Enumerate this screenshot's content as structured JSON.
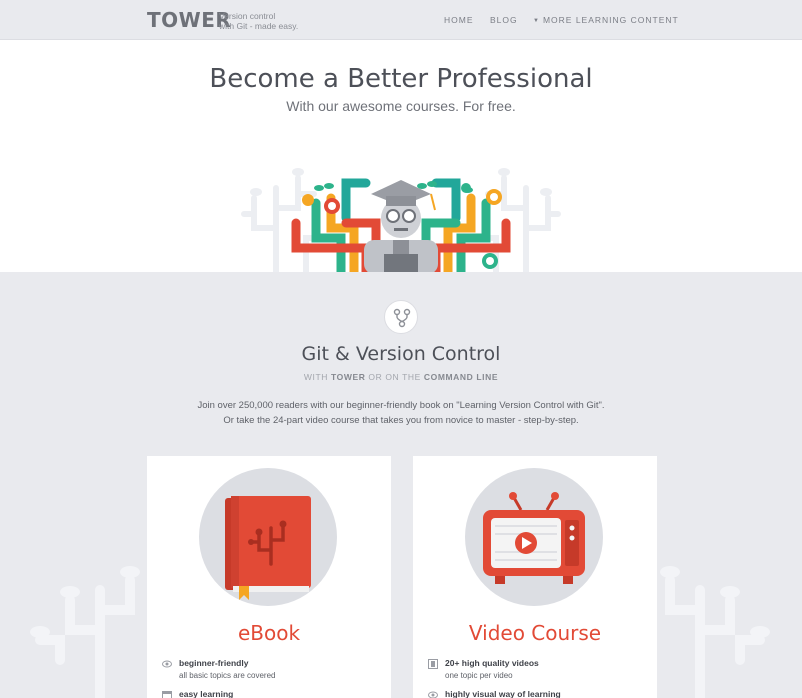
{
  "header": {
    "logo": "TOWER",
    "tagline_line1": "Version control",
    "tagline_line2": "with Git - made easy.",
    "nav": {
      "home": "HOME",
      "blog": "BLOG",
      "more": "MORE LEARNING CONTENT"
    }
  },
  "hero": {
    "title": "Become a Better Professional",
    "subtitle": "With our awesome courses. For free."
  },
  "section": {
    "title": "Git & Version Control",
    "sub_with": "WITH",
    "sub_tower": "TOWER",
    "sub_or": "OR ON THE",
    "sub_cli": "COMMAND LINE",
    "desc_line1": "Join over 250,000 readers with our beginner-friendly book on \"Learning Version Control with Git\".",
    "desc_line2": "Or take the 24-part video course that takes you from novice to master - step-by-step."
  },
  "cards": [
    {
      "title": "eBook",
      "features": [
        {
          "icon": "eye-icon",
          "title": "beginner-friendly",
          "subtitle": "all basic topics are covered"
        },
        {
          "icon": "calendar-icon",
          "title": "easy learning",
          "subtitle": ""
        }
      ]
    },
    {
      "title": "Video Course",
      "features": [
        {
          "icon": "film-icon",
          "title": "20+ high quality videos",
          "subtitle": "one topic per video"
        },
        {
          "icon": "eye-icon",
          "title": "highly visual way of learning",
          "subtitle": ""
        }
      ]
    }
  ],
  "colors": {
    "accent": "#e24a36",
    "background": "#e9eaee",
    "card": "#ffffff",
    "green": "#2db38b",
    "orange": "#f5a623",
    "teal": "#22a79a"
  }
}
